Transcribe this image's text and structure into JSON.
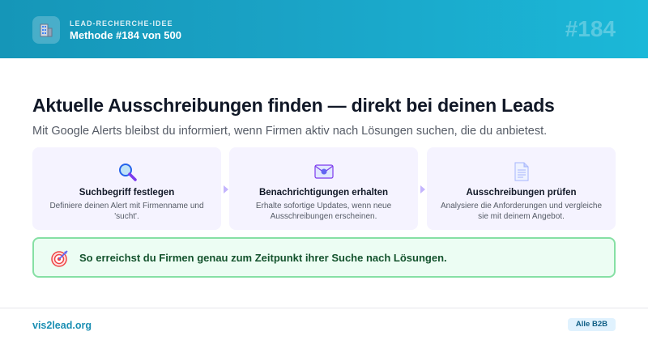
{
  "header": {
    "icon": "office-building-icon",
    "kicker": "LEAD-RECHERCHE-IDEE",
    "title": "Methode #184 von 500",
    "number": "#184"
  },
  "main": {
    "headline": "Aktuelle Ausschreibungen finden — direkt bei deinen Leads",
    "subline": "Mit Google Alerts bleibst du informiert, wenn Firmen aktiv nach Lösungen suchen, die du anbietest."
  },
  "steps": [
    {
      "icon": "magnifier-icon",
      "title": "Suchbegriff festlegen",
      "desc": "Definiere deinen Alert mit Firmenname und 'sucht'."
    },
    {
      "icon": "email-icon",
      "title": "Benachrichtigungen erhalten",
      "desc": "Erhalte sofortige Updates, wenn neue Ausschreibungen erscheinen."
    },
    {
      "icon": "document-icon",
      "title": "Ausschreibungen prüfen",
      "desc": "Analysiere die Anforderungen und vergleiche sie mit deinem Angebot."
    }
  ],
  "callout": {
    "icon": "target-icon",
    "text": "So erreichst du Firmen genau zum Zeitpunkt ihrer Suche nach Lösungen."
  },
  "footer": {
    "link": "vis2lead.org",
    "badge": "Alle B2B"
  },
  "colors": {
    "header_start": "#1596b8",
    "header_end": "#1bb8d8",
    "step_bg": "#f5f3ff",
    "callout_bg": "#ecfdf3",
    "callout_border": "#86e0a4",
    "link": "#1b8fb3"
  }
}
